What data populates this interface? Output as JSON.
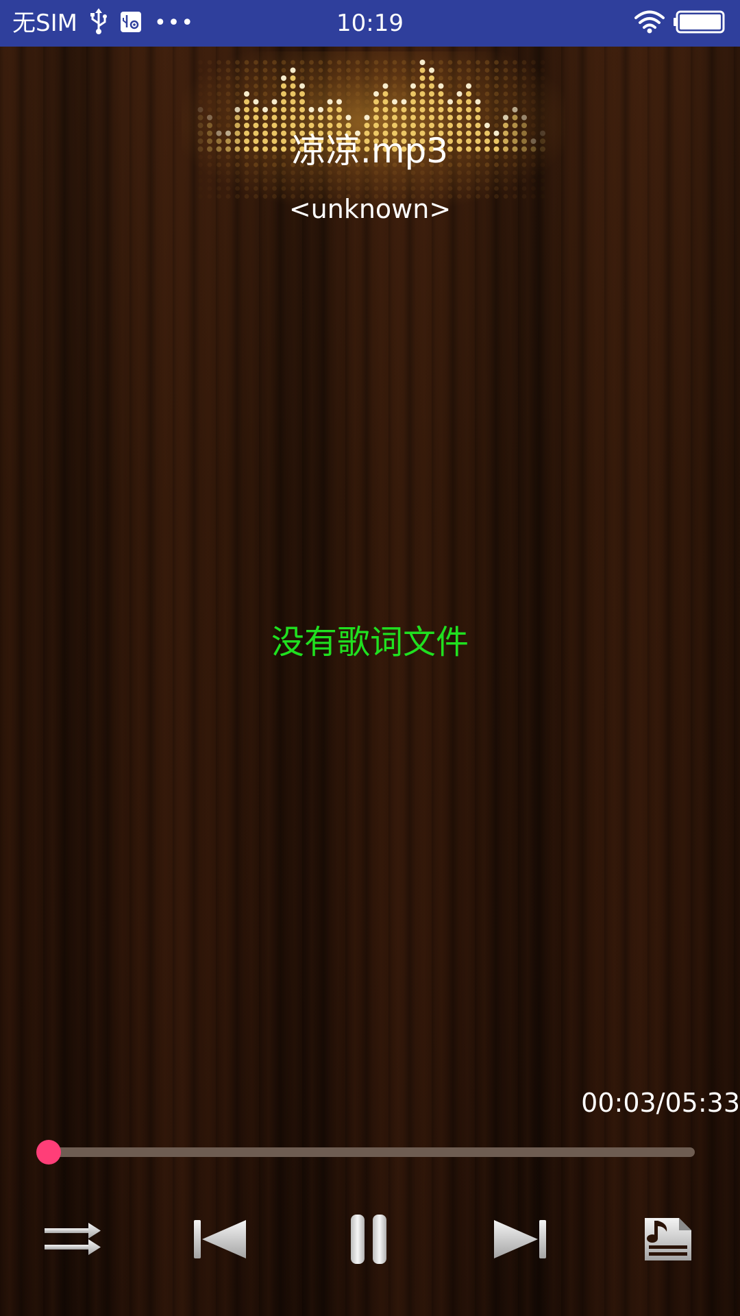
{
  "status_bar": {
    "carrier": "无SIM",
    "time": "10:19",
    "icons": [
      "usb-icon",
      "usb-debug-icon",
      "more-dots-icon",
      "wifi-icon",
      "battery-icon"
    ],
    "more_dots": "•••",
    "background_color": "#2f3f9c"
  },
  "player": {
    "title": "凉凉.mp3",
    "artist": "<unknown>",
    "lyrics_message": "没有歌词文件",
    "lyrics_color": "#20e020",
    "time_readout": "00:03/05:33",
    "progress": {
      "current_seconds": 3,
      "total_seconds": 333,
      "accent_color": "#ff3e78"
    },
    "controls": [
      {
        "name": "play-mode-button",
        "icon": "shuffle-repeat-icon"
      },
      {
        "name": "previous-button",
        "icon": "previous-track-icon"
      },
      {
        "name": "pause-button",
        "icon": "pause-icon"
      },
      {
        "name": "next-button",
        "icon": "next-track-icon"
      },
      {
        "name": "playlist-button",
        "icon": "music-file-list-icon"
      }
    ]
  }
}
